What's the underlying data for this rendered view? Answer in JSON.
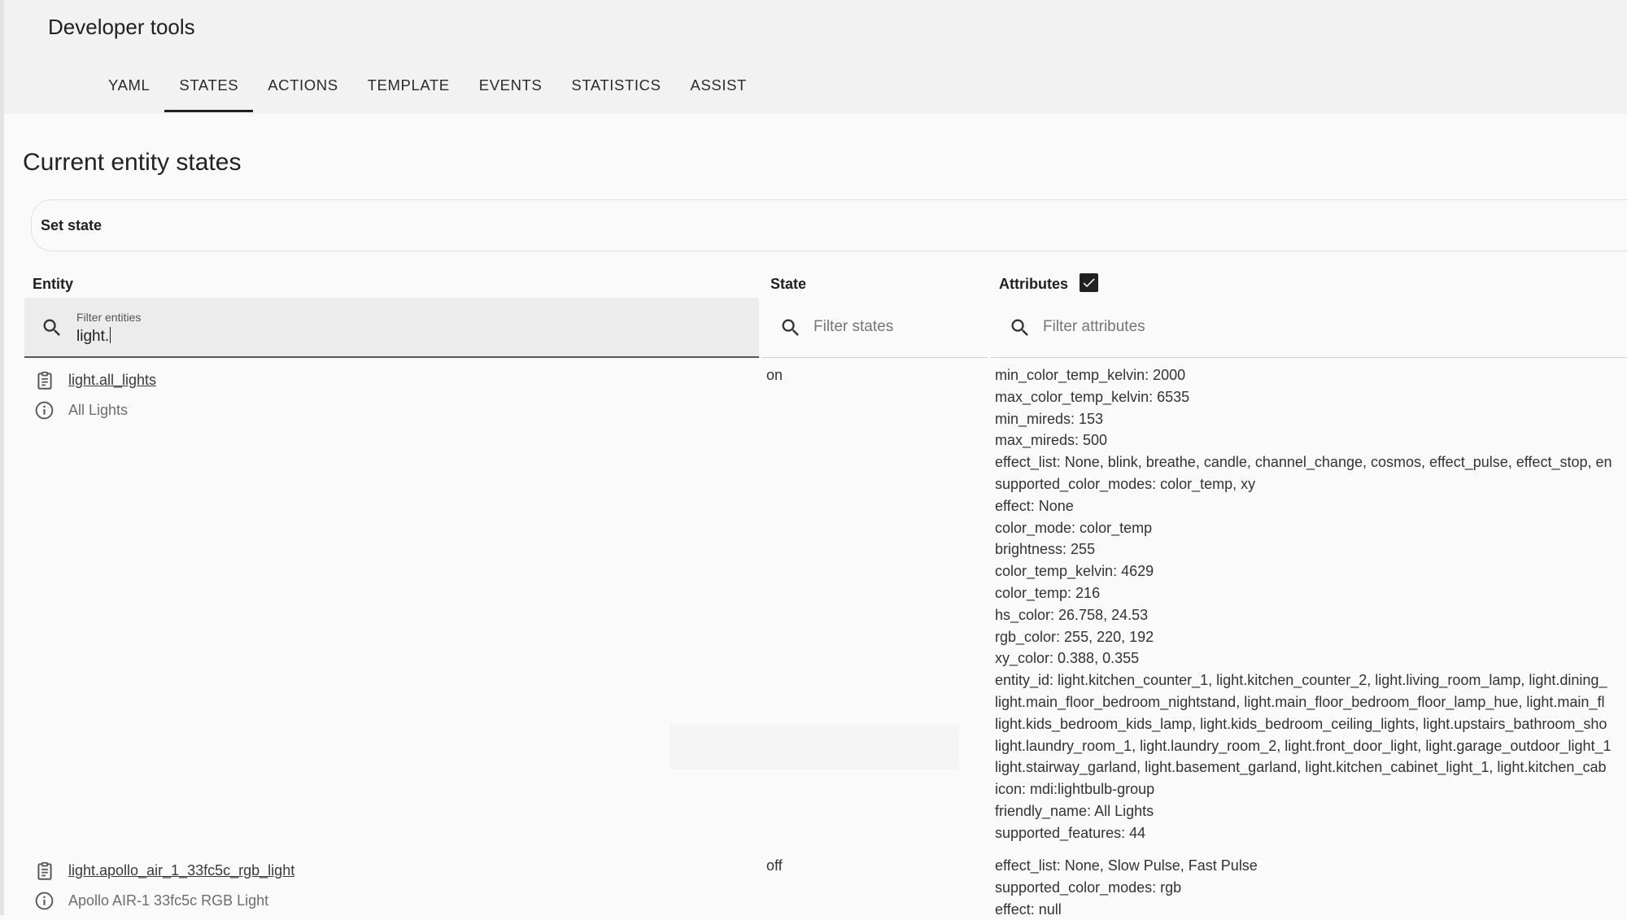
{
  "header": {
    "title": "Developer tools"
  },
  "tabs": [
    {
      "label": "YAML",
      "active": false
    },
    {
      "label": "STATES",
      "active": true
    },
    {
      "label": "ACTIONS",
      "active": false
    },
    {
      "label": "TEMPLATE",
      "active": false
    },
    {
      "label": "EVENTS",
      "active": false
    },
    {
      "label": "STATISTICS",
      "active": false
    },
    {
      "label": "ASSIST",
      "active": false
    }
  ],
  "main": {
    "title": "Current entity states",
    "set_state_label": "Set state"
  },
  "table": {
    "headers": {
      "entity": "Entity",
      "state": "State",
      "attributes": "Attributes"
    },
    "attributes_checked": true,
    "filters": {
      "entity": {
        "label": "Filter entities",
        "value": "light."
      },
      "state": {
        "placeholder": "Filter states"
      },
      "attributes": {
        "placeholder": "Filter attributes"
      }
    },
    "rows": [
      {
        "entity_id": "light.all_lights",
        "friendly_name": "All Lights",
        "state": "on",
        "attributes": [
          "min_color_temp_kelvin: 2000",
          "max_color_temp_kelvin: 6535",
          "min_mireds: 153",
          "max_mireds: 500",
          "effect_list: None, blink, breathe, candle, channel_change, cosmos, effect_pulse, effect_stop, en",
          "supported_color_modes: color_temp, xy",
          "effect: None",
          "color_mode: color_temp",
          "brightness: 255",
          "color_temp_kelvin: 4629",
          "color_temp: 216",
          "hs_color: 26.758, 24.53",
          "rgb_color: 255, 220, 192",
          "xy_color: 0.388, 0.355",
          "entity_id: light.kitchen_counter_1, light.kitchen_counter_2, light.living_room_lamp, light.dining_",
          "light.main_floor_bedroom_nightstand, light.main_floor_bedroom_floor_lamp_hue, light.main_fl",
          "light.kids_bedroom_kids_lamp, light.kids_bedroom_ceiling_lights, light.upstairs_bathroom_sho",
          "light.laundry_room_1, light.laundry_room_2, light.front_door_light, light.garage_outdoor_light_1",
          "light.stairway_garland, light.basement_garland, light.kitchen_cabinet_light_1, light.kitchen_cab",
          "icon: mdi:lightbulb-group",
          "friendly_name: All Lights",
          "supported_features: 44"
        ]
      },
      {
        "entity_id": "light.apollo_air_1_33fc5c_rgb_light",
        "friendly_name": "Apollo AIR-1 33fc5c RGB Light",
        "state": "off",
        "attributes": [
          "effect_list: None, Slow Pulse, Fast Pulse",
          "supported_color_modes: rgb",
          "effect: null"
        ]
      }
    ]
  },
  "icons": {
    "search": "search-icon",
    "clipboard": "clipboard-icon",
    "info": "info-icon",
    "checkbox": "checkbox-checked-icon"
  }
}
